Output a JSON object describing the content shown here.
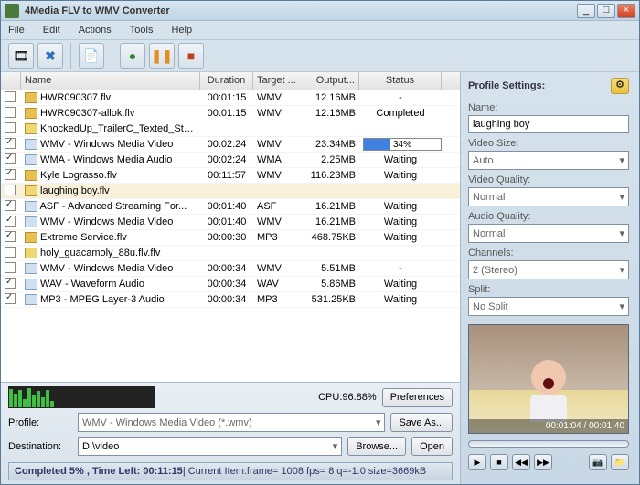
{
  "window": {
    "title": "4Media FLV to WMV Converter"
  },
  "menu": {
    "file": "File",
    "edit": "Edit",
    "actions": "Actions",
    "tools": "Tools",
    "help": "Help"
  },
  "columns": {
    "name": "Name",
    "duration": "Duration",
    "target": "Target ...",
    "output": "Output...",
    "status": "Status"
  },
  "rows": [
    {
      "chk": false,
      "indent": 1,
      "icon": "file",
      "name": "HWR090307.flv",
      "dur": "00:01:15",
      "tgt": "WMV",
      "out": "12.16MB",
      "stat": "-"
    },
    {
      "chk": false,
      "indent": 1,
      "icon": "file",
      "name": "HWR090307-allok.flv",
      "dur": "00:01:15",
      "tgt": "WMV",
      "out": "12.16MB",
      "stat": "Completed"
    },
    {
      "chk": false,
      "indent": 0,
      "icon": "fold",
      "name": "KnockedUp_TrailerC_Texted_Ster...",
      "dur": "",
      "tgt": "",
      "out": "",
      "stat": ""
    },
    {
      "chk": true,
      "indent": 2,
      "icon": "child",
      "name": "WMV - Windows Media Video",
      "dur": "00:02:24",
      "tgt": "WMV",
      "out": "23.34MB",
      "stat": "",
      "progress": 34
    },
    {
      "chk": true,
      "indent": 2,
      "icon": "child",
      "name": "WMA - Windows Media Audio",
      "dur": "00:02:24",
      "tgt": "WMA",
      "out": "2.25MB",
      "stat": "Waiting"
    },
    {
      "chk": true,
      "indent": 1,
      "icon": "file",
      "name": "Kyle Lograsso.flv",
      "dur": "00:11:57",
      "tgt": "WMV",
      "out": "116.23MB",
      "stat": "Waiting"
    },
    {
      "chk": false,
      "indent": 0,
      "icon": "fold",
      "name": "laughing boy.flv",
      "dur": "",
      "tgt": "",
      "out": "",
      "stat": "",
      "sel": true
    },
    {
      "chk": true,
      "indent": 2,
      "icon": "child",
      "name": "ASF - Advanced Streaming For...",
      "dur": "00:01:40",
      "tgt": "ASF",
      "out": "16.21MB",
      "stat": "Waiting"
    },
    {
      "chk": true,
      "indent": 2,
      "icon": "child",
      "name": "WMV - Windows Media Video",
      "dur": "00:01:40",
      "tgt": "WMV",
      "out": "16.21MB",
      "stat": "Waiting"
    },
    {
      "chk": true,
      "indent": 1,
      "icon": "file",
      "name": "Extreme Service.flv",
      "dur": "00:00:30",
      "tgt": "MP3",
      "out": "468.75KB",
      "stat": "Waiting"
    },
    {
      "chk": false,
      "indent": 0,
      "icon": "fold",
      "name": "holy_guacamoly_88u.flv.flv",
      "dur": "",
      "tgt": "",
      "out": "",
      "stat": ""
    },
    {
      "chk": false,
      "indent": 2,
      "icon": "child",
      "name": "WMV - Windows Media Video",
      "dur": "00:00:34",
      "tgt": "WMV",
      "out": "5.51MB",
      "stat": "-"
    },
    {
      "chk": true,
      "indent": 2,
      "icon": "child",
      "name": "WAV - Waveform Audio",
      "dur": "00:00:34",
      "tgt": "WAV",
      "out": "5.86MB",
      "stat": "Waiting"
    },
    {
      "chk": true,
      "indent": 2,
      "icon": "child",
      "name": "MP3 - MPEG Layer-3 Audio",
      "dur": "00:00:34",
      "tgt": "MP3",
      "out": "531.25KB",
      "stat": "Waiting"
    }
  ],
  "cpu": {
    "label": "CPU:96.88%"
  },
  "buttons": {
    "preferences": "Preferences",
    "saveas": "Save As...",
    "browse": "Browse...",
    "open": "Open"
  },
  "profile": {
    "label": "Profile:",
    "value": "WMV - Windows Media Video (*.wmv)"
  },
  "destination": {
    "label": "Destination:",
    "value": "D:\\video"
  },
  "statusbar": {
    "bold": "Completed 5% , Time Left: 00:11:15",
    "rest": " | Current Item:frame= 1008 fps=  8 q=-1.0 size=3669kB"
  },
  "settings": {
    "title": "Profile Settings:",
    "name_label": "Name:",
    "name": "laughing boy",
    "vsize_label": "Video Size:",
    "vsize": "Auto",
    "vq_label": "Video Quality:",
    "vq": "Normal",
    "aq_label": "Audio Quality:",
    "aq": "Normal",
    "ch_label": "Channels:",
    "ch": "2 (Stereo)",
    "split_label": "Split:",
    "split": "No Split"
  },
  "player": {
    "time": "00:01:04 / 00:01:40"
  }
}
